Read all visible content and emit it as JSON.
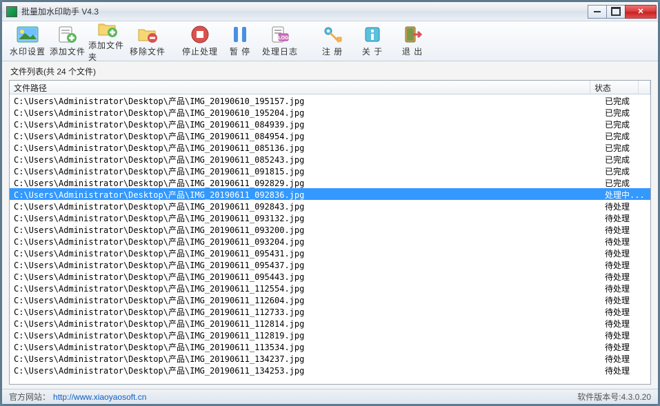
{
  "titlebar": {
    "title": "批量加水印助手 V4.3"
  },
  "toolbar": {
    "watermark_settings": "水印设置",
    "add_files": "添加文件",
    "add_folder": "添加文件夹",
    "remove_files": "移除文件",
    "stop_process": "停止处理",
    "pause": "暂 停",
    "process_log": "处理日志",
    "register": "注 册",
    "about": "关 于",
    "exit": "退 出"
  },
  "list": {
    "caption": "文件列表(共 24 个文件)",
    "header_path": "文件路径",
    "header_status": "状态",
    "status": {
      "done": "已完成",
      "processing": "处理中...",
      "pending": "待处理"
    },
    "rows": [
      {
        "path": "C:\\Users\\Administrator\\Desktop\\产品\\IMG_20190610_195157.jpg",
        "status": "done"
      },
      {
        "path": "C:\\Users\\Administrator\\Desktop\\产品\\IMG_20190610_195204.jpg",
        "status": "done"
      },
      {
        "path": "C:\\Users\\Administrator\\Desktop\\产品\\IMG_20190611_084939.jpg",
        "status": "done"
      },
      {
        "path": "C:\\Users\\Administrator\\Desktop\\产品\\IMG_20190611_084954.jpg",
        "status": "done"
      },
      {
        "path": "C:\\Users\\Administrator\\Desktop\\产品\\IMG_20190611_085136.jpg",
        "status": "done"
      },
      {
        "path": "C:\\Users\\Administrator\\Desktop\\产品\\IMG_20190611_085243.jpg",
        "status": "done"
      },
      {
        "path": "C:\\Users\\Administrator\\Desktop\\产品\\IMG_20190611_091815.jpg",
        "status": "done"
      },
      {
        "path": "C:\\Users\\Administrator\\Desktop\\产品\\IMG_20190611_092829.jpg",
        "status": "done"
      },
      {
        "path": "C:\\Users\\Administrator\\Desktop\\产品\\IMG_20190611_092836.jpg",
        "status": "processing",
        "selected": true
      },
      {
        "path": "C:\\Users\\Administrator\\Desktop\\产品\\IMG_20190611_092843.jpg",
        "status": "pending"
      },
      {
        "path": "C:\\Users\\Administrator\\Desktop\\产品\\IMG_20190611_093132.jpg",
        "status": "pending"
      },
      {
        "path": "C:\\Users\\Administrator\\Desktop\\产品\\IMG_20190611_093200.jpg",
        "status": "pending"
      },
      {
        "path": "C:\\Users\\Administrator\\Desktop\\产品\\IMG_20190611_093204.jpg",
        "status": "pending"
      },
      {
        "path": "C:\\Users\\Administrator\\Desktop\\产品\\IMG_20190611_095431.jpg",
        "status": "pending"
      },
      {
        "path": "C:\\Users\\Administrator\\Desktop\\产品\\IMG_20190611_095437.jpg",
        "status": "pending"
      },
      {
        "path": "C:\\Users\\Administrator\\Desktop\\产品\\IMG_20190611_095443.jpg",
        "status": "pending"
      },
      {
        "path": "C:\\Users\\Administrator\\Desktop\\产品\\IMG_20190611_112554.jpg",
        "status": "pending"
      },
      {
        "path": "C:\\Users\\Administrator\\Desktop\\产品\\IMG_20190611_112604.jpg",
        "status": "pending"
      },
      {
        "path": "C:\\Users\\Administrator\\Desktop\\产品\\IMG_20190611_112733.jpg",
        "status": "pending"
      },
      {
        "path": "C:\\Users\\Administrator\\Desktop\\产品\\IMG_20190611_112814.jpg",
        "status": "pending"
      },
      {
        "path": "C:\\Users\\Administrator\\Desktop\\产品\\IMG_20190611_112819.jpg",
        "status": "pending"
      },
      {
        "path": "C:\\Users\\Administrator\\Desktop\\产品\\IMG_20190611_113534.jpg",
        "status": "pending"
      },
      {
        "path": "C:\\Users\\Administrator\\Desktop\\产品\\IMG_20190611_134237.jpg",
        "status": "pending"
      },
      {
        "path": "C:\\Users\\Administrator\\Desktop\\产品\\IMG_20190611_134253.jpg",
        "status": "pending"
      }
    ]
  },
  "statusbar": {
    "website_label": "官方网站：",
    "website_url": "http://www.xiaoyaosoft.cn",
    "version_label": "软件版本号:",
    "version": "4.3.0.20"
  }
}
